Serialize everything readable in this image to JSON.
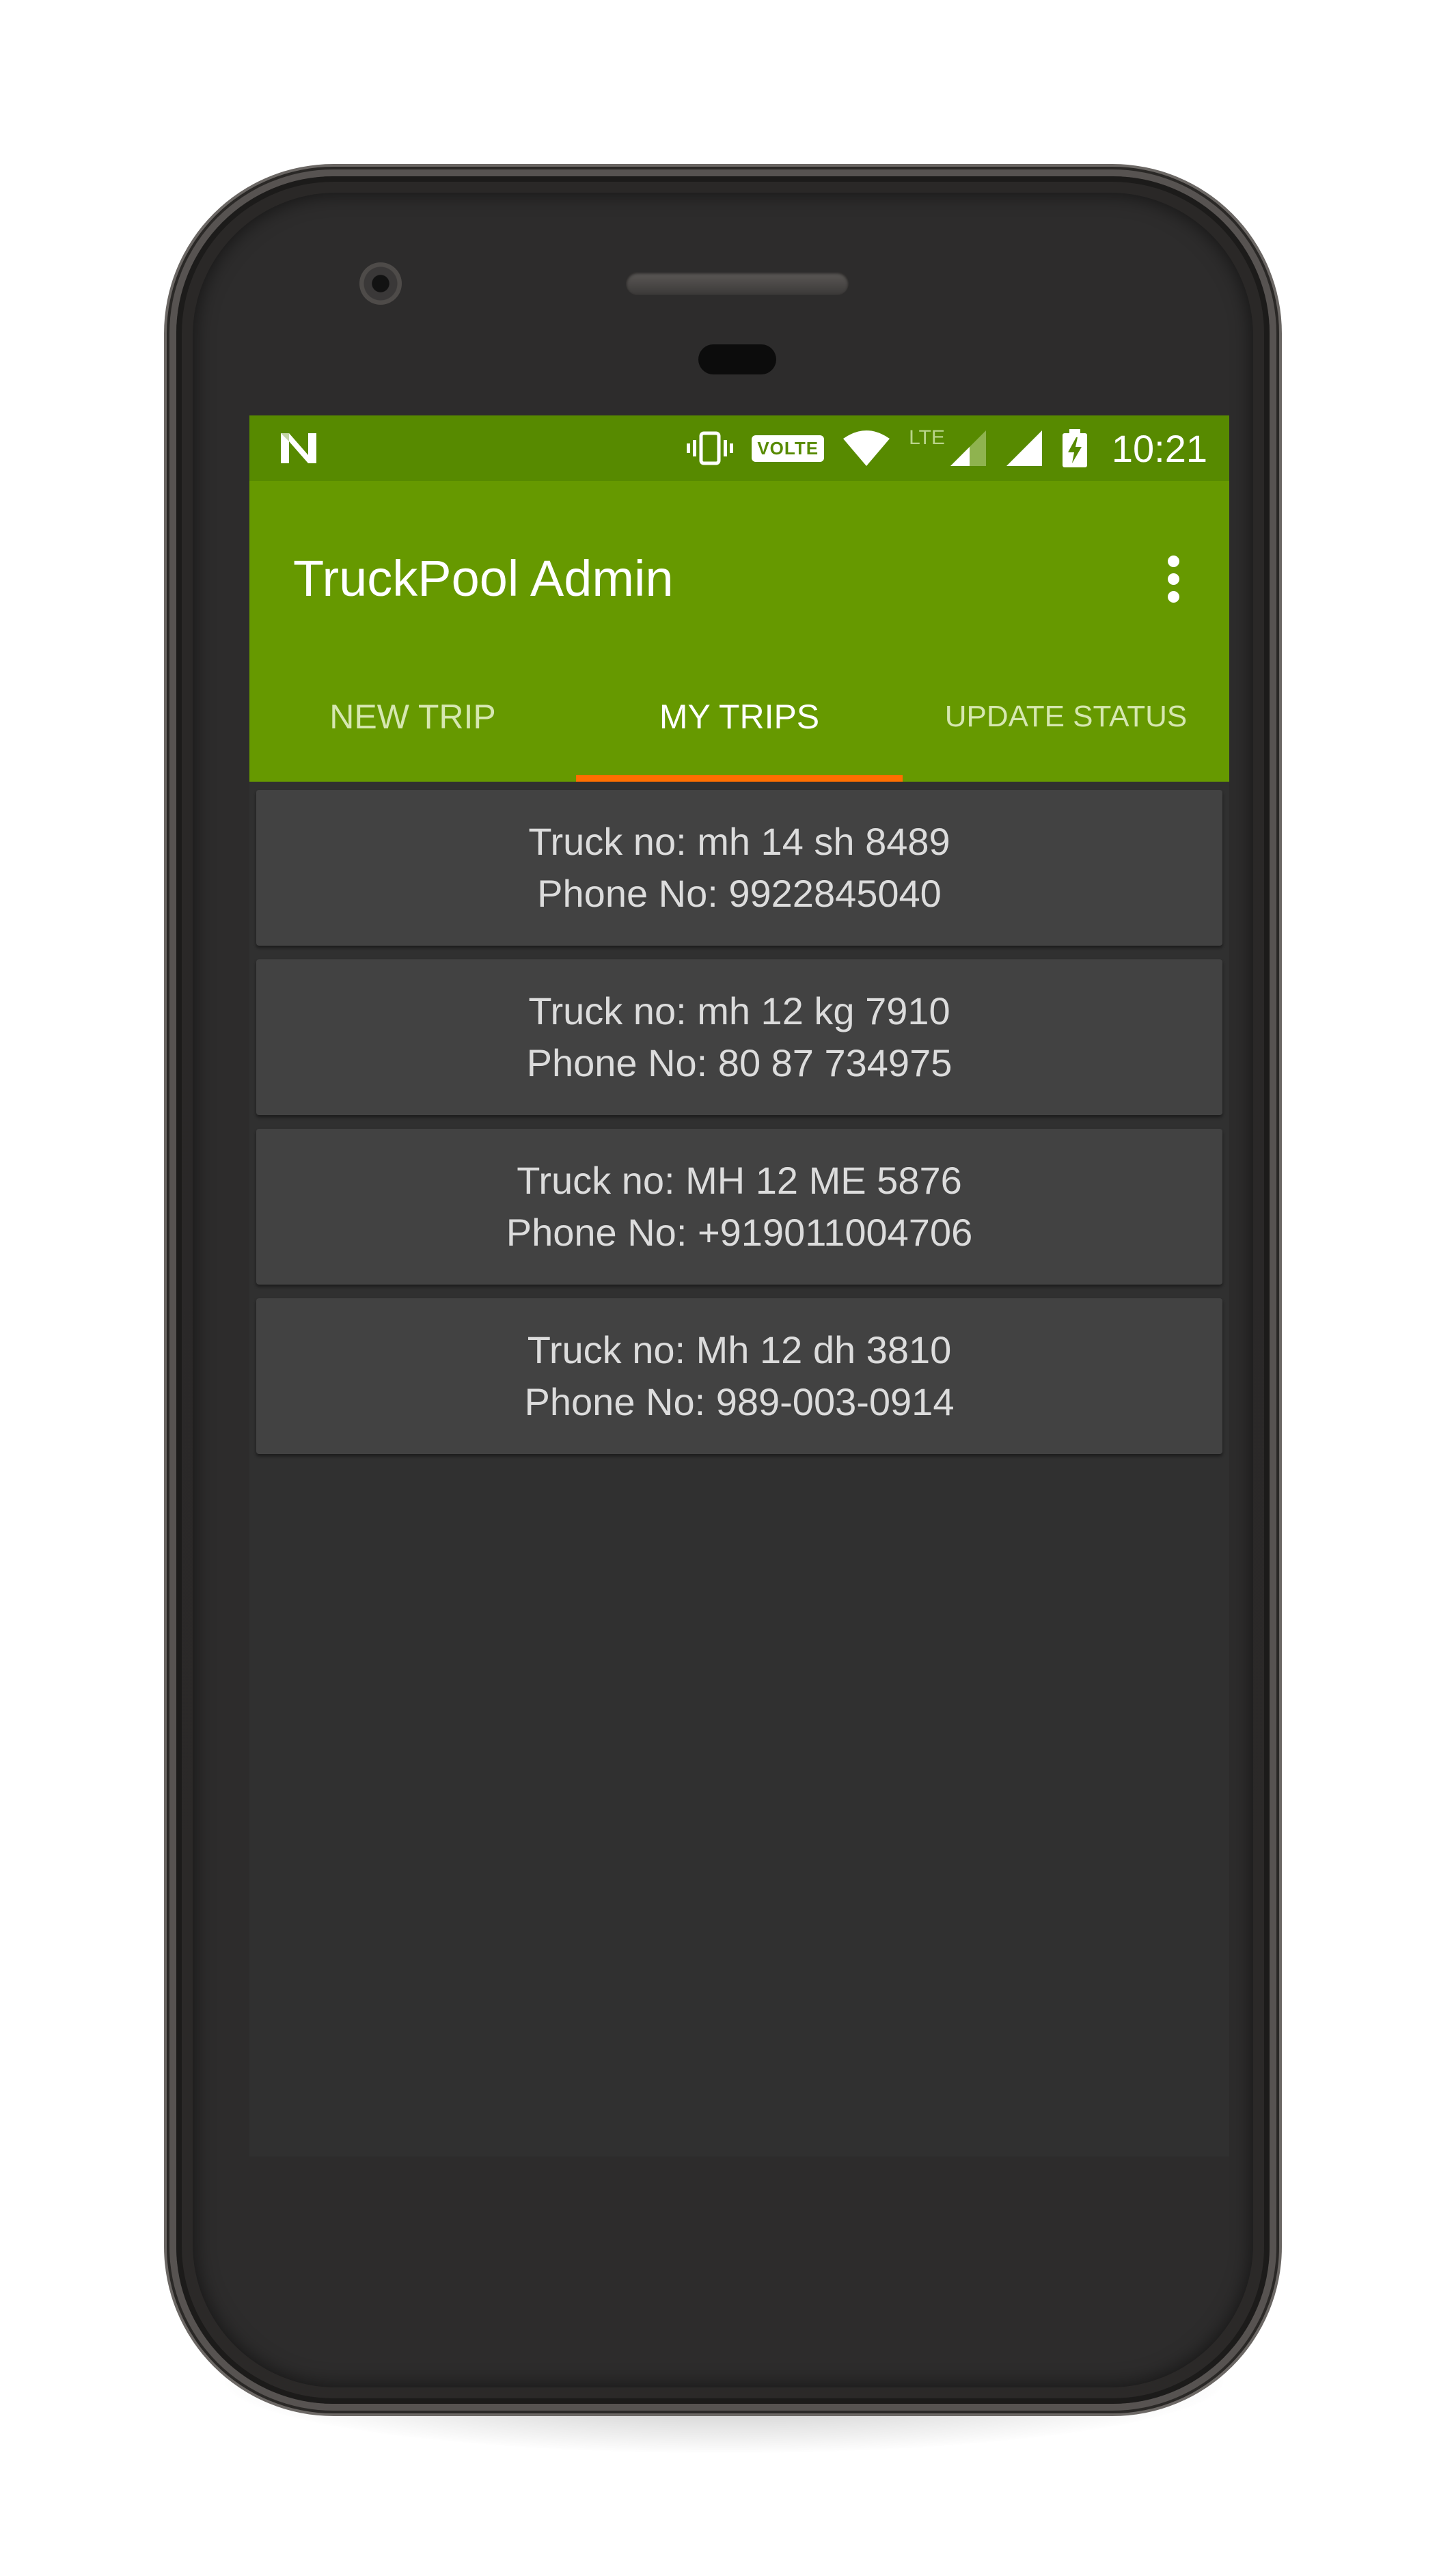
{
  "status_bar": {
    "time": "10:21",
    "volte": "VOLTE",
    "network": "LTE"
  },
  "app_bar": {
    "title": "TruckPool Admin",
    "tabs": [
      {
        "label": "NEW TRIP",
        "active": false
      },
      {
        "label": "MY TRIPS",
        "active": true
      },
      {
        "label": "UPDATE STATUS",
        "active": false
      }
    ]
  },
  "trips": [
    {
      "truck": "Truck no: mh 14 sh 8489",
      "phone": "Phone No: 9922845040"
    },
    {
      "truck": "Truck no: mh 12 kg 7910",
      "phone": "Phone No: 80 87 734975"
    },
    {
      "truck": "Truck no: MH 12 ME 5876",
      "phone": "Phone No: +919011004706"
    },
    {
      "truck": "Truck no: Mh 12 dh 3810",
      "phone": "Phone No: 989-003-0914"
    }
  ],
  "colors": {
    "primary": "#669900",
    "primary_dark": "#578a00",
    "accent": "#ff6f00",
    "background": "#303030",
    "card": "#424242"
  },
  "icons": {
    "notification": "n-notification-icon",
    "vibrate": "vibrate-icon",
    "wifi": "wifi-icon",
    "signal": "signal-icon",
    "battery": "battery-charging-icon",
    "overflow": "overflow-menu-icon",
    "back": "back-icon",
    "home": "home-icon",
    "recents": "recents-icon"
  }
}
